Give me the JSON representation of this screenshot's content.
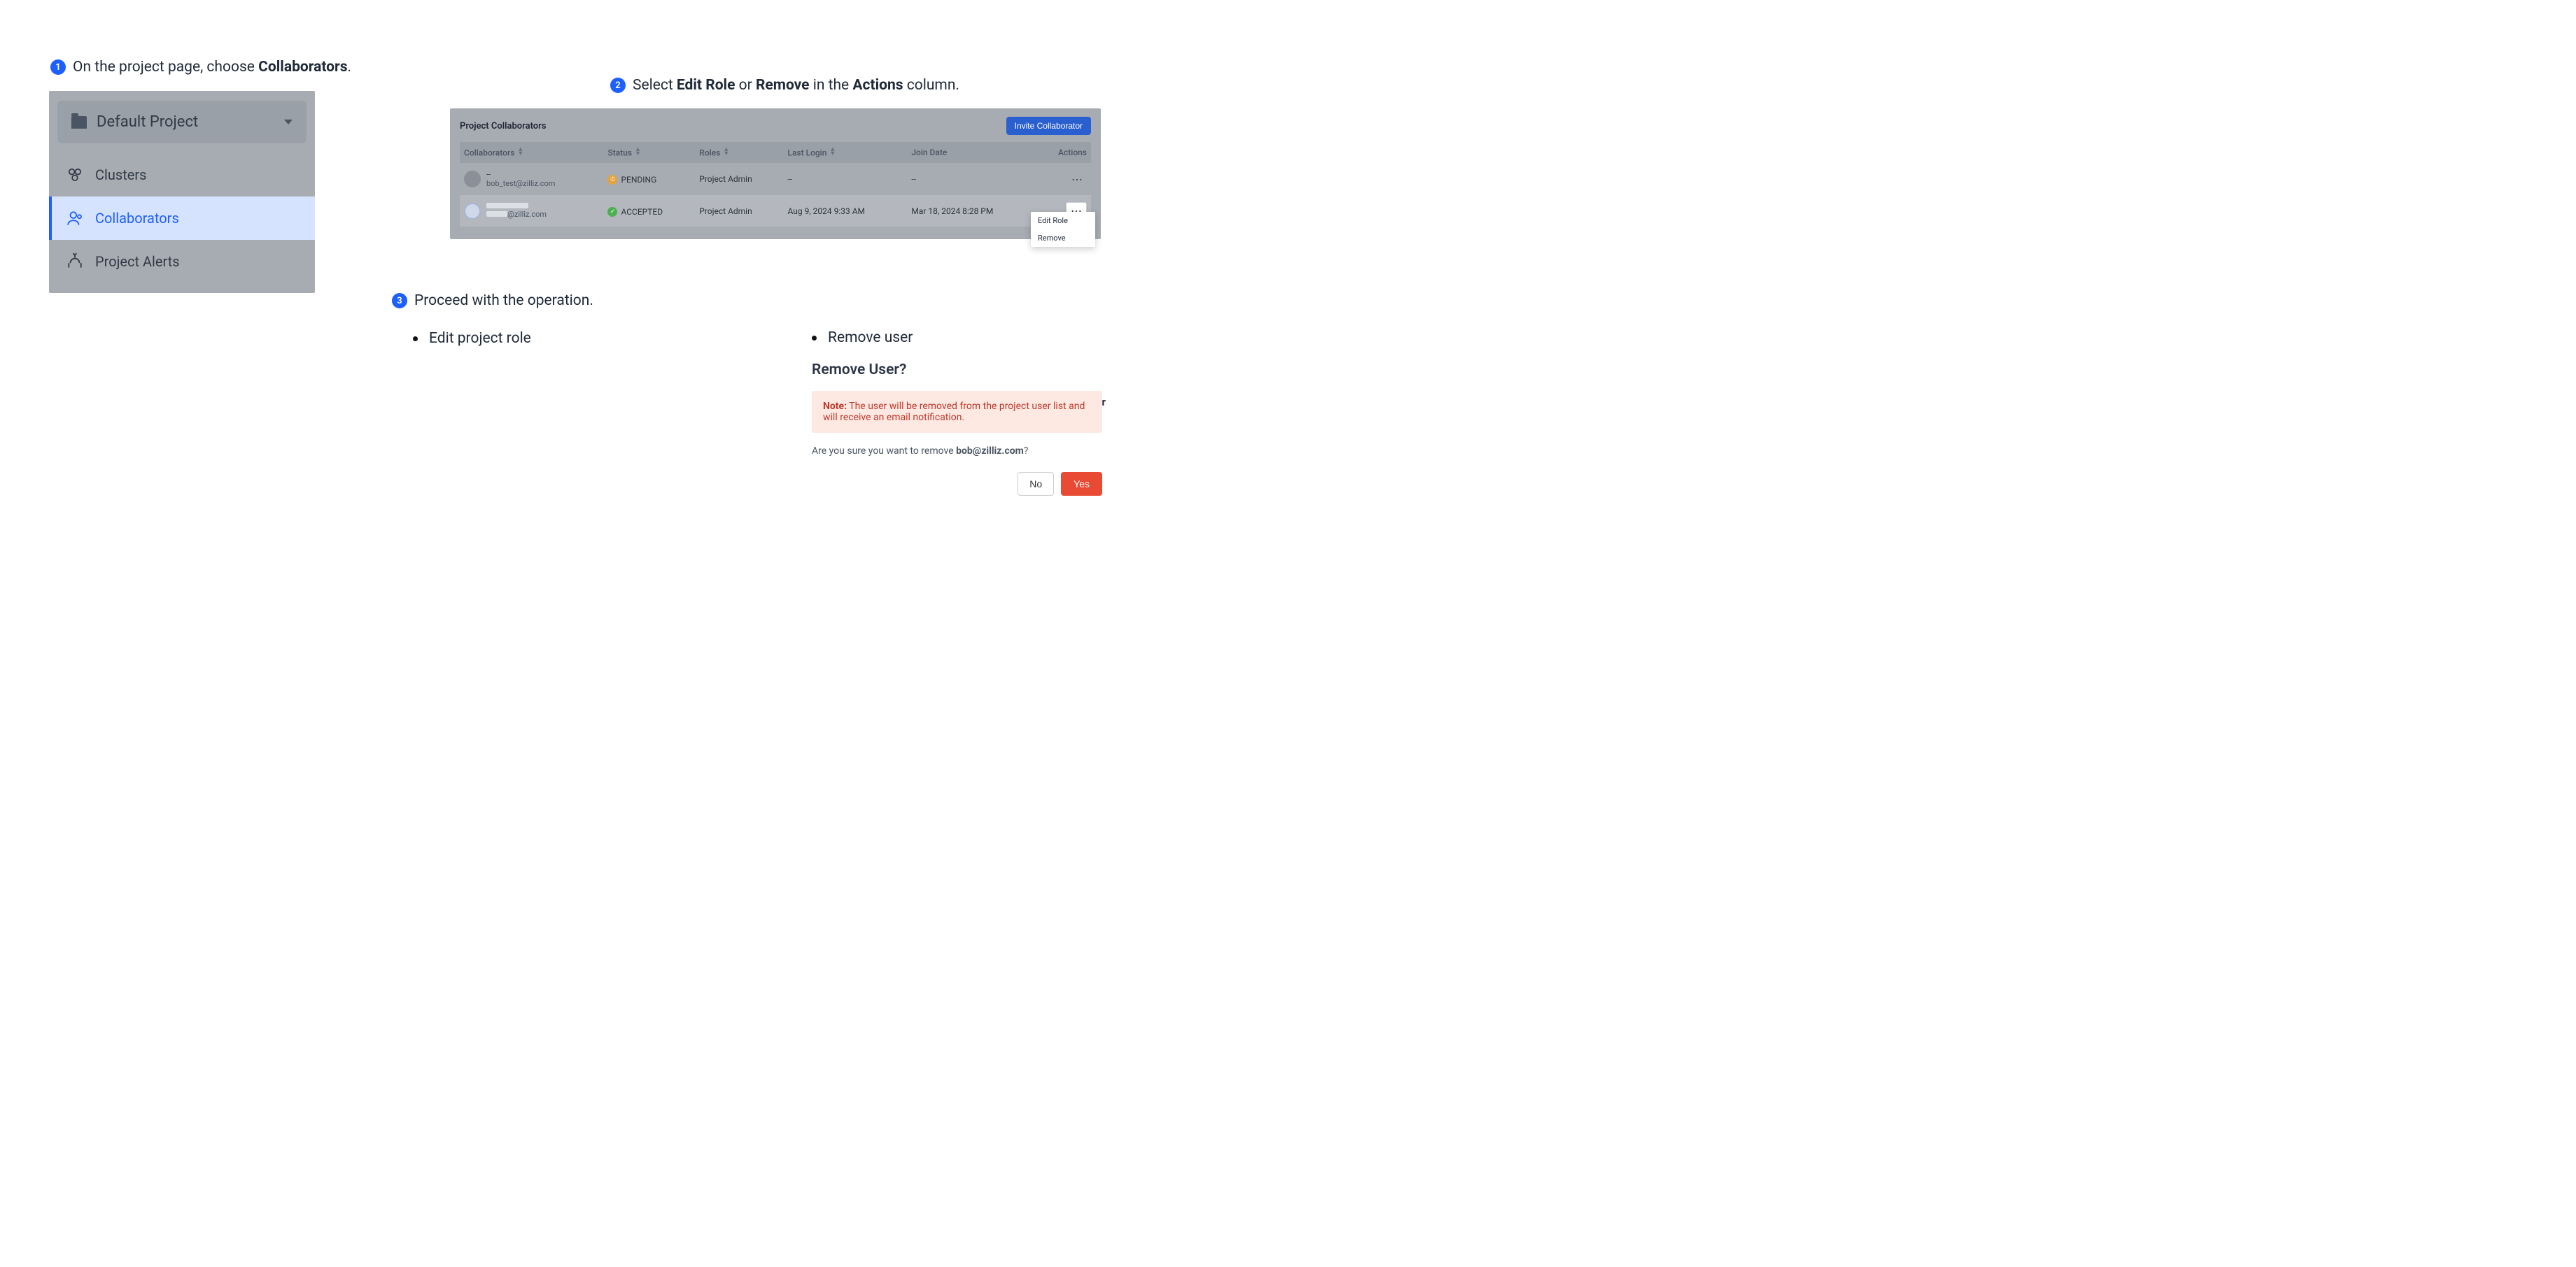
{
  "step1": {
    "badge": "1",
    "text_pre": "On the project page, choose ",
    "text_bold": "Collaborators",
    "text_post": "."
  },
  "sidebar": {
    "project_name": "Default Project",
    "items": [
      {
        "label": "Clusters"
      },
      {
        "label": "Collaborators"
      },
      {
        "label": "Project Alerts"
      }
    ]
  },
  "step2": {
    "badge": "2",
    "text_pre": "Select ",
    "bold1": "Edit Role",
    "mid1": " or ",
    "bold2": "Remove",
    "mid2": " in the ",
    "bold3": "Actions",
    "text_post": " column."
  },
  "table": {
    "title": "Project Collaborators",
    "invite_label": "Invite Collaborator",
    "headers": {
      "collaborators": "Collaborators",
      "status": "Status",
      "roles": "Roles",
      "last_login": "Last Login",
      "join_date": "Join Date",
      "actions": "Actions"
    },
    "rows": [
      {
        "name": "--",
        "email": "bob_test@zilliz.com",
        "status_label": "PENDING",
        "role": "Project Admin",
        "last_login": "--",
        "join_date": "--"
      },
      {
        "name": "",
        "email_suffix": "@zilliz.com",
        "status_label": "ACCEPTED",
        "role": "Project Admin",
        "last_login": "Aug 9, 2024 9:33 AM",
        "join_date": "Mar 18, 2024 8:28 PM"
      }
    ],
    "menu": {
      "edit_role": "Edit Role",
      "remove": "Remove"
    }
  },
  "step3": {
    "badge": "3",
    "text": "Proceed with the operation.",
    "bullet_edit": "Edit project role",
    "or": "or",
    "bullet_remove": "Remove user"
  },
  "remove_dialog": {
    "title": "Remove User?",
    "note_label": "Note:",
    "note_text": " The user will be removed from the project user list and will receive an email notification.",
    "confirm_pre": "Are you sure you want to remove ",
    "confirm_bold": "bob@zilliz.com",
    "confirm_post": "?",
    "no_label": "No",
    "yes_label": "Yes"
  }
}
